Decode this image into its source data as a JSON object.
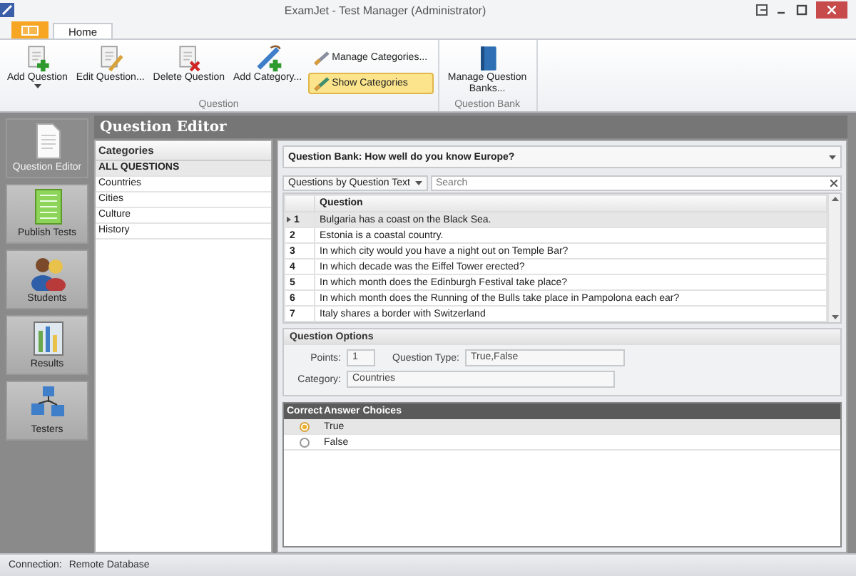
{
  "window": {
    "title": "ExamJet - Test Manager (Administrator)"
  },
  "ribbon": {
    "tabs": [
      {
        "label": "Home",
        "selected": true
      }
    ],
    "groups": [
      {
        "label": "Question",
        "buttons": [
          {
            "label": "Add Question",
            "kind": "split"
          },
          {
            "label": "Edit Question...",
            "kind": "large"
          },
          {
            "label": "Delete Question",
            "kind": "large"
          },
          {
            "label": "Add Category...",
            "kind": "large"
          },
          {
            "label": "Manage Categories...",
            "kind": "small",
            "selected": false
          },
          {
            "label": "Show Categories",
            "kind": "small",
            "selected": true
          }
        ]
      },
      {
        "label": "Question Bank",
        "buttons": [
          {
            "label": "Manage Question Banks...",
            "kind": "large"
          }
        ]
      }
    ]
  },
  "sidebar": {
    "items": [
      {
        "label": "Question Editor",
        "selected": true
      },
      {
        "label": "Publish Tests",
        "selected": false
      },
      {
        "label": "Students",
        "selected": false
      },
      {
        "label": "Results",
        "selected": false
      },
      {
        "label": "Testers",
        "selected": false
      }
    ]
  },
  "editor": {
    "title": "Question Editor",
    "categories": {
      "heading": "Categories",
      "items": [
        {
          "label": "ALL QUESTIONS",
          "selected": true
        },
        {
          "label": "Countries",
          "selected": false
        },
        {
          "label": "Cities",
          "selected": false
        },
        {
          "label": "Culture",
          "selected": false
        },
        {
          "label": "History",
          "selected": false
        }
      ]
    },
    "question_bank": "Question Bank: How well do you know Europe?",
    "filter": "Questions by Question Text",
    "search": {
      "placeholder": "Search"
    },
    "table": {
      "columns": [
        "Question"
      ],
      "rows": [
        {
          "number": "1",
          "text": "Bulgaria has a coast on the Black Sea.",
          "selected": true
        },
        {
          "number": "2",
          "text": "Estonia is a coastal country.",
          "selected": false
        },
        {
          "number": "3",
          "text": "In which city would you have a night out on Temple Bar?",
          "selected": false
        },
        {
          "number": "4",
          "text": "In which decade was the Eiffel Tower erected?",
          "selected": false
        },
        {
          "number": "5",
          "text": "In which month does the Edinburgh Festival take place?",
          "selected": false
        },
        {
          "number": "6",
          "text": "In which month does the Running of the Bulls take place in Pampolona each ear?",
          "selected": false
        },
        {
          "number": "7",
          "text": "Italy shares a border with Switzerland",
          "selected": false
        }
      ]
    },
    "options": {
      "title": "Question Options",
      "points_label": "Points:",
      "points": "1",
      "type_label": "Question Type:",
      "type": "True,False",
      "category_label": "Category:",
      "category": "Countries"
    },
    "answers": {
      "columns": [
        "Correct",
        "Answer Choices"
      ],
      "rows": [
        {
          "text": "True",
          "selected": true
        },
        {
          "text": "False",
          "selected": false
        }
      ]
    }
  },
  "status_bar": {
    "label": "Connection:",
    "value": "Remote Database"
  }
}
